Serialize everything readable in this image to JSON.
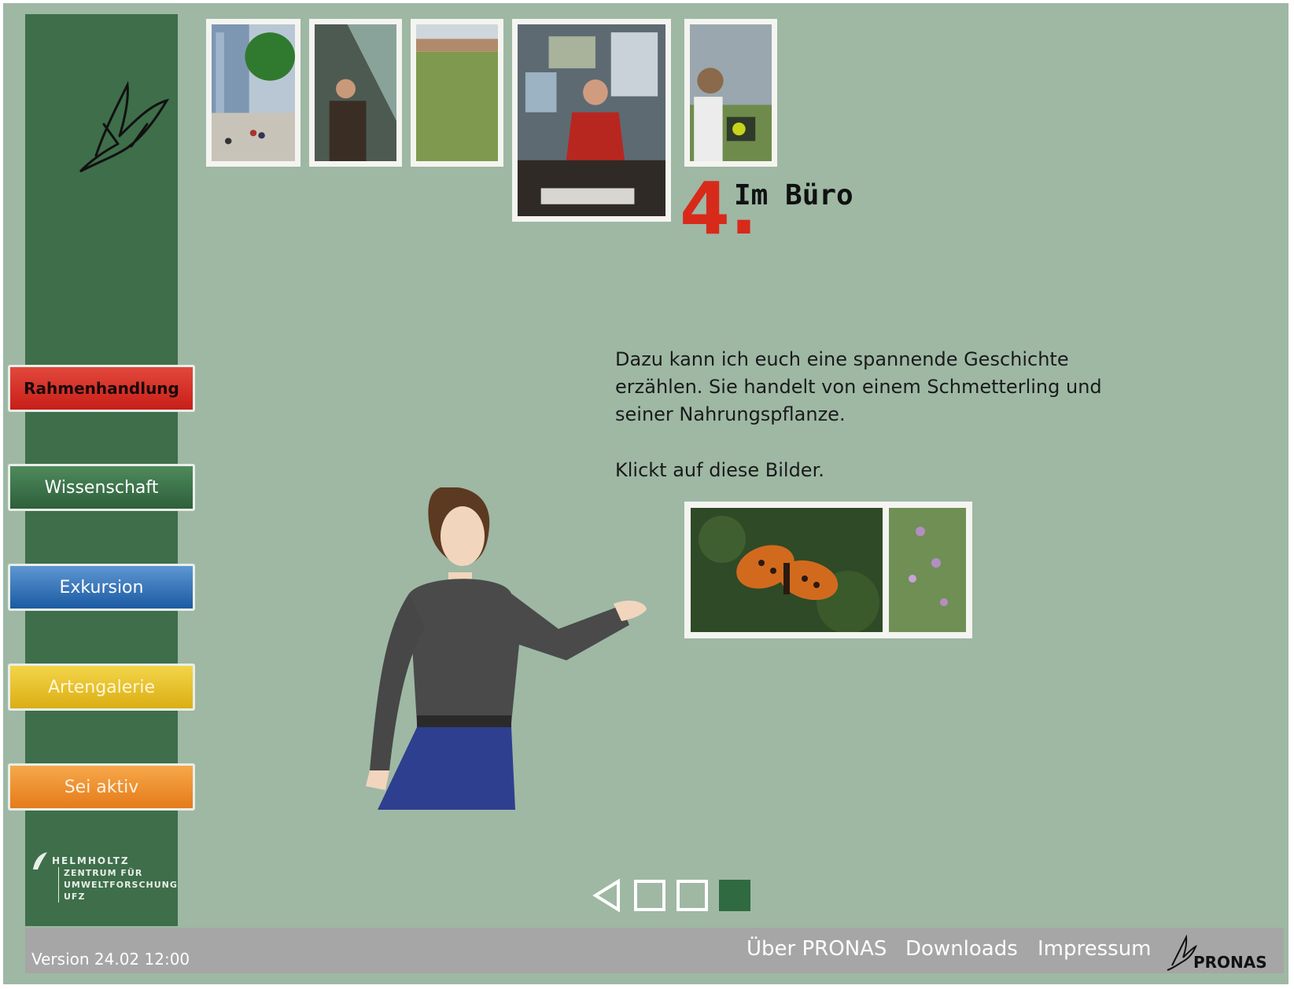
{
  "nav": {
    "rahmen": "Rahmenhandlung",
    "wissenschaft": "Wissenschaft",
    "exkursion": "Exkursion",
    "artengalerie": "Artengalerie",
    "aktiv": "Sei aktiv"
  },
  "institution": {
    "name": "HELMHOLTZ",
    "line1": "ZENTRUM FÜR",
    "line2": "UMWELTFORSCHUNG",
    "line3": "UFZ"
  },
  "chapter": {
    "number": "4.",
    "title": "Im Büro"
  },
  "content": {
    "paragraph1": "Dazu kann ich euch eine spannende Geschichte erzählen. Sie handelt von einem Schmetterling und seiner Nahrungspflanze.",
    "paragraph2": "Klickt auf diese Bilder."
  },
  "pager": {
    "prev_icon": "triangle-left-icon",
    "pages": 3,
    "active": 3
  },
  "footer": {
    "version": "Version 24.02 12:00",
    "links": [
      "Über PRONAS",
      "Downloads",
      "Impressum"
    ],
    "brand": "PRONAS"
  },
  "colors": {
    "background": "#9eb8a4",
    "sidebar": "#3e6e4a",
    "rahmen": "#d32a22",
    "wissenschaft": "#3a7447",
    "exkursion": "#2f6fb8",
    "artengalerie": "#e6c025",
    "aktiv": "#ee8f2c",
    "chapter_number": "#d82a1a",
    "active_page": "#2f6a41",
    "footer": "#a6a6a6"
  }
}
